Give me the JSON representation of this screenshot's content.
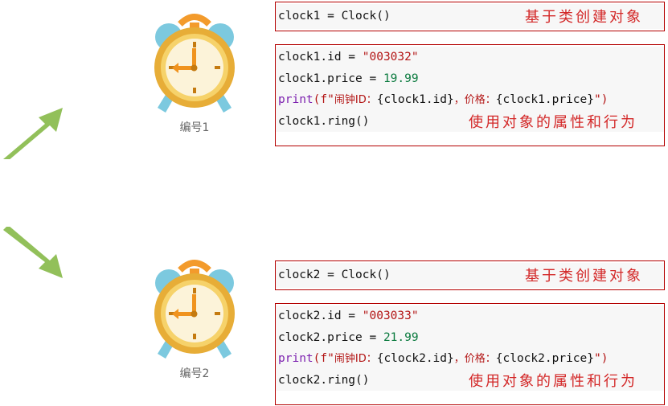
{
  "colors": {
    "arrow": "#92c05a",
    "box_border": "#b40000",
    "annotation": "#d32727",
    "string": "#b31515",
    "number": "#0a7a3e",
    "keyword": "#7d22b0"
  },
  "clock1": {
    "icon": "alarm-clock-icon",
    "caption": "编号1",
    "create": {
      "code": "clock1 = Clock()",
      "note": "基于类创建对象"
    },
    "usage": {
      "line1_prefix": "clock1.id = ",
      "line1_value": "\"003032\"",
      "line2_prefix": "clock1.price = ",
      "line2_value": "19.99",
      "line3_kw": "print",
      "line3_paren": "(f\"",
      "line3_cn": "闹钟ID：",
      "line3_mid1": "{clock1.id}",
      "line3_cn2": "，价格：",
      "line3_mid2": "{clock1.price}",
      "line3_end": "\")",
      "line4": "clock1.ring()",
      "note": "使用对象的属性和行为"
    }
  },
  "clock2": {
    "icon": "alarm-clock-icon",
    "caption": "编号2",
    "create": {
      "code": "clock2 = Clock()",
      "note": "基于类创建对象"
    },
    "usage": {
      "line1_prefix": "clock2.id = ",
      "line1_value": "\"003033\"",
      "line2_prefix": "clock2.price = ",
      "line2_value": "21.99",
      "line3_kw": "print",
      "line3_paren": "(f\"",
      "line3_cn": "闹钟ID：",
      "line3_mid1": "{clock2.id}",
      "line3_cn2": "，价格：",
      "line3_mid2": "{clock2.price}",
      "line3_end": "\")",
      "line4": "clock2.ring()",
      "note": "使用对象的属性和行为"
    }
  }
}
